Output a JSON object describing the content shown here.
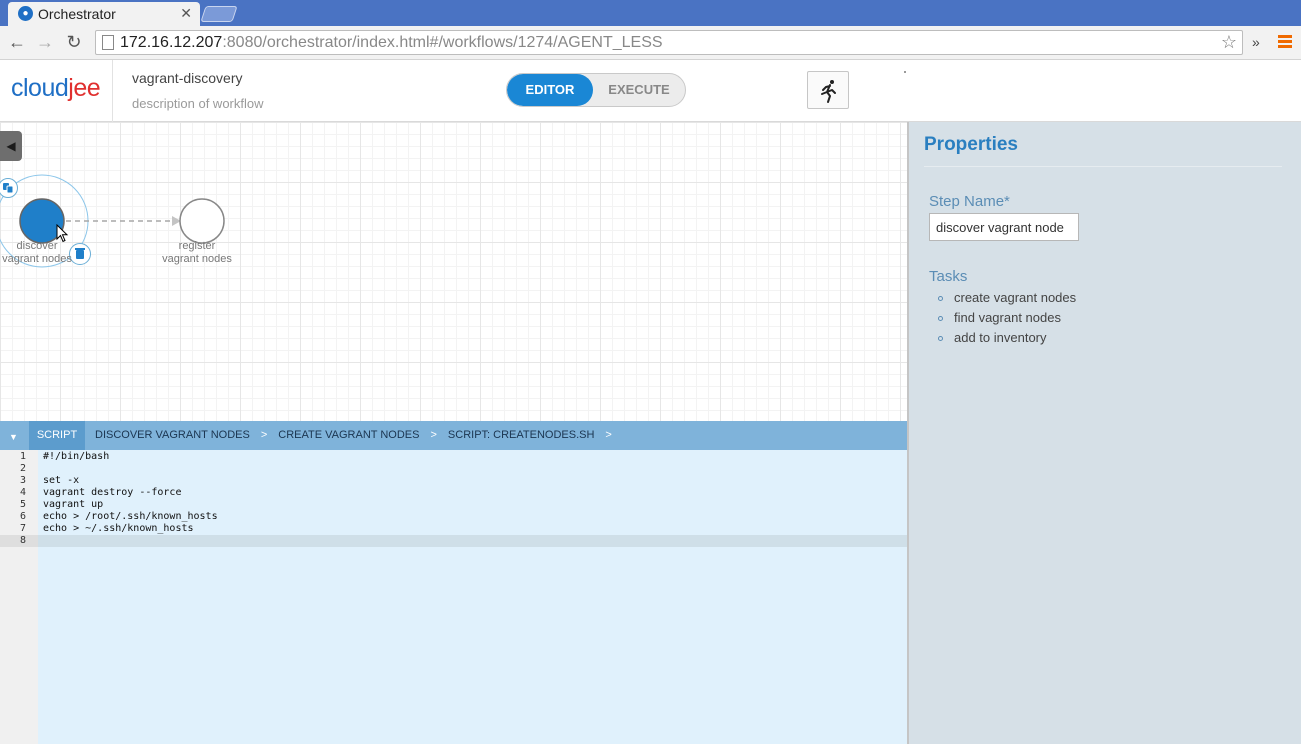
{
  "browser": {
    "tab_title": "Orchestrator",
    "url_host": "172.16.12.207",
    "url_rest": ":8080/orchestrator/index.html#/workflows/1274/AGENT_LESS",
    "icons": [
      "back-icon",
      "forward-icon",
      "reload-icon",
      "page-icon",
      "star-icon",
      "menu-icon"
    ]
  },
  "header": {
    "logo_part1": "cloud",
    "logo_part2": "jee",
    "workflow_title": "vagrant-discovery",
    "workflow_description": "description of workflow",
    "mode_editor": "EDITOR",
    "mode_execute": "EXECUTE",
    "active_mode": "EDITOR",
    "run_icon": "running-man-icon"
  },
  "canvas": {
    "nodes": [
      {
        "label_line1": "discover",
        "label_line2": "vagrant nodes",
        "selected": true
      },
      {
        "label_line1": "register",
        "label_line2": "vagrant nodes",
        "selected": false
      }
    ]
  },
  "editor": {
    "tab_label": "SCRIPT",
    "breadcrumb": [
      "DISCOVER VAGRANT NODES",
      "CREATE VAGRANT NODES",
      "SCRIPT: CREATENODES.SH"
    ],
    "lines": [
      "#!/bin/bash",
      "",
      "set -x",
      "vagrant destroy --force",
      "vagrant up",
      "echo > /root/.ssh/known_hosts",
      "echo > ~/.ssh/known_hosts",
      ""
    ],
    "line_numbers": [
      "1",
      "2",
      "3",
      "4",
      "5",
      "6",
      "7",
      "8"
    ],
    "active_line": 8
  },
  "properties": {
    "title": "Properties",
    "step_name_label": "Step Name*",
    "step_name_value": "discover vagrant node",
    "tasks_label": "Tasks",
    "tasks": [
      "create vagrant nodes",
      "find vagrant nodes",
      "add to inventory"
    ]
  },
  "colors": {
    "accent": "#1a87d5",
    "header_bar": "#7fb3da",
    "code_bg": "#e0f1fc",
    "panel_bg": "#d6e0e7",
    "node_fill": "#1f7fc9"
  }
}
